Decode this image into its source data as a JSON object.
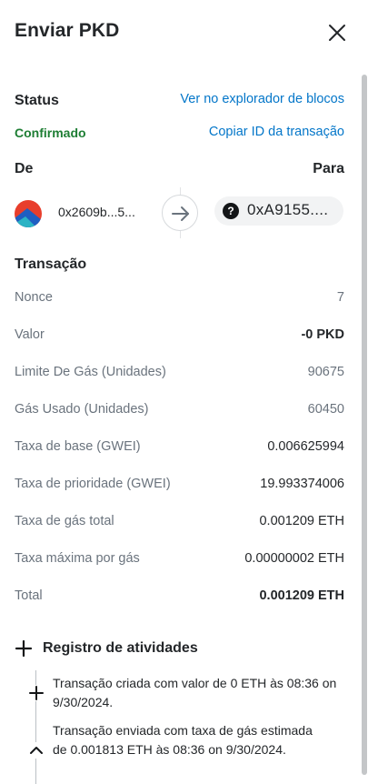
{
  "header": {
    "title": "Enviar PKD"
  },
  "status": {
    "label": "Status",
    "value": "Confirmado",
    "explorer_link": "Ver no explorador de blocos",
    "copy_link": "Copiar ID da transação"
  },
  "parties": {
    "from_label": "De",
    "to_label": "Para",
    "from_address": "0x2609b...5...",
    "to_address": "0xA9155....",
    "to_icon_glyph": "?"
  },
  "transaction": {
    "title": "Transação",
    "rows": [
      {
        "label": "Nonce",
        "value": "7"
      },
      {
        "label": "Valor",
        "value": "-0 PKD"
      },
      {
        "label": "Limite De Gás (Unidades)",
        "value": "90675"
      },
      {
        "label": "Gás Usado (Unidades)",
        "value": "60450"
      },
      {
        "label": "Taxa de base (GWEI)",
        "value": "0.006625994"
      },
      {
        "label": "Taxa de prioridade (GWEI)",
        "value": "19.993374006"
      },
      {
        "label": "Taxa de gás total",
        "value": "0.001209 ETH"
      },
      {
        "label": "Taxa máxima por gás",
        "value": "0.00000002 ETH"
      },
      {
        "label": "Total",
        "value": "0.001209 ETH"
      }
    ]
  },
  "activity": {
    "title": "Registro de atividades",
    "entries": [
      {
        "text": "Transação criada com valor de 0 ETH às 08:36 on 9/30/2024."
      },
      {
        "text": "Transação enviada com taxa de gás estimada de 0.001813 ETH às 08:36 on 9/30/2024."
      }
    ]
  },
  "colors": {
    "link": "#0376c9",
    "confirmed": "#1e7e34",
    "muted_text": "#6a737d",
    "primary_text": "#24272a"
  },
  "icons": {
    "close": "close-icon",
    "arrow": "arrow-right-icon",
    "plus": "plus-icon",
    "caret_up": "chevron-up-icon"
  }
}
